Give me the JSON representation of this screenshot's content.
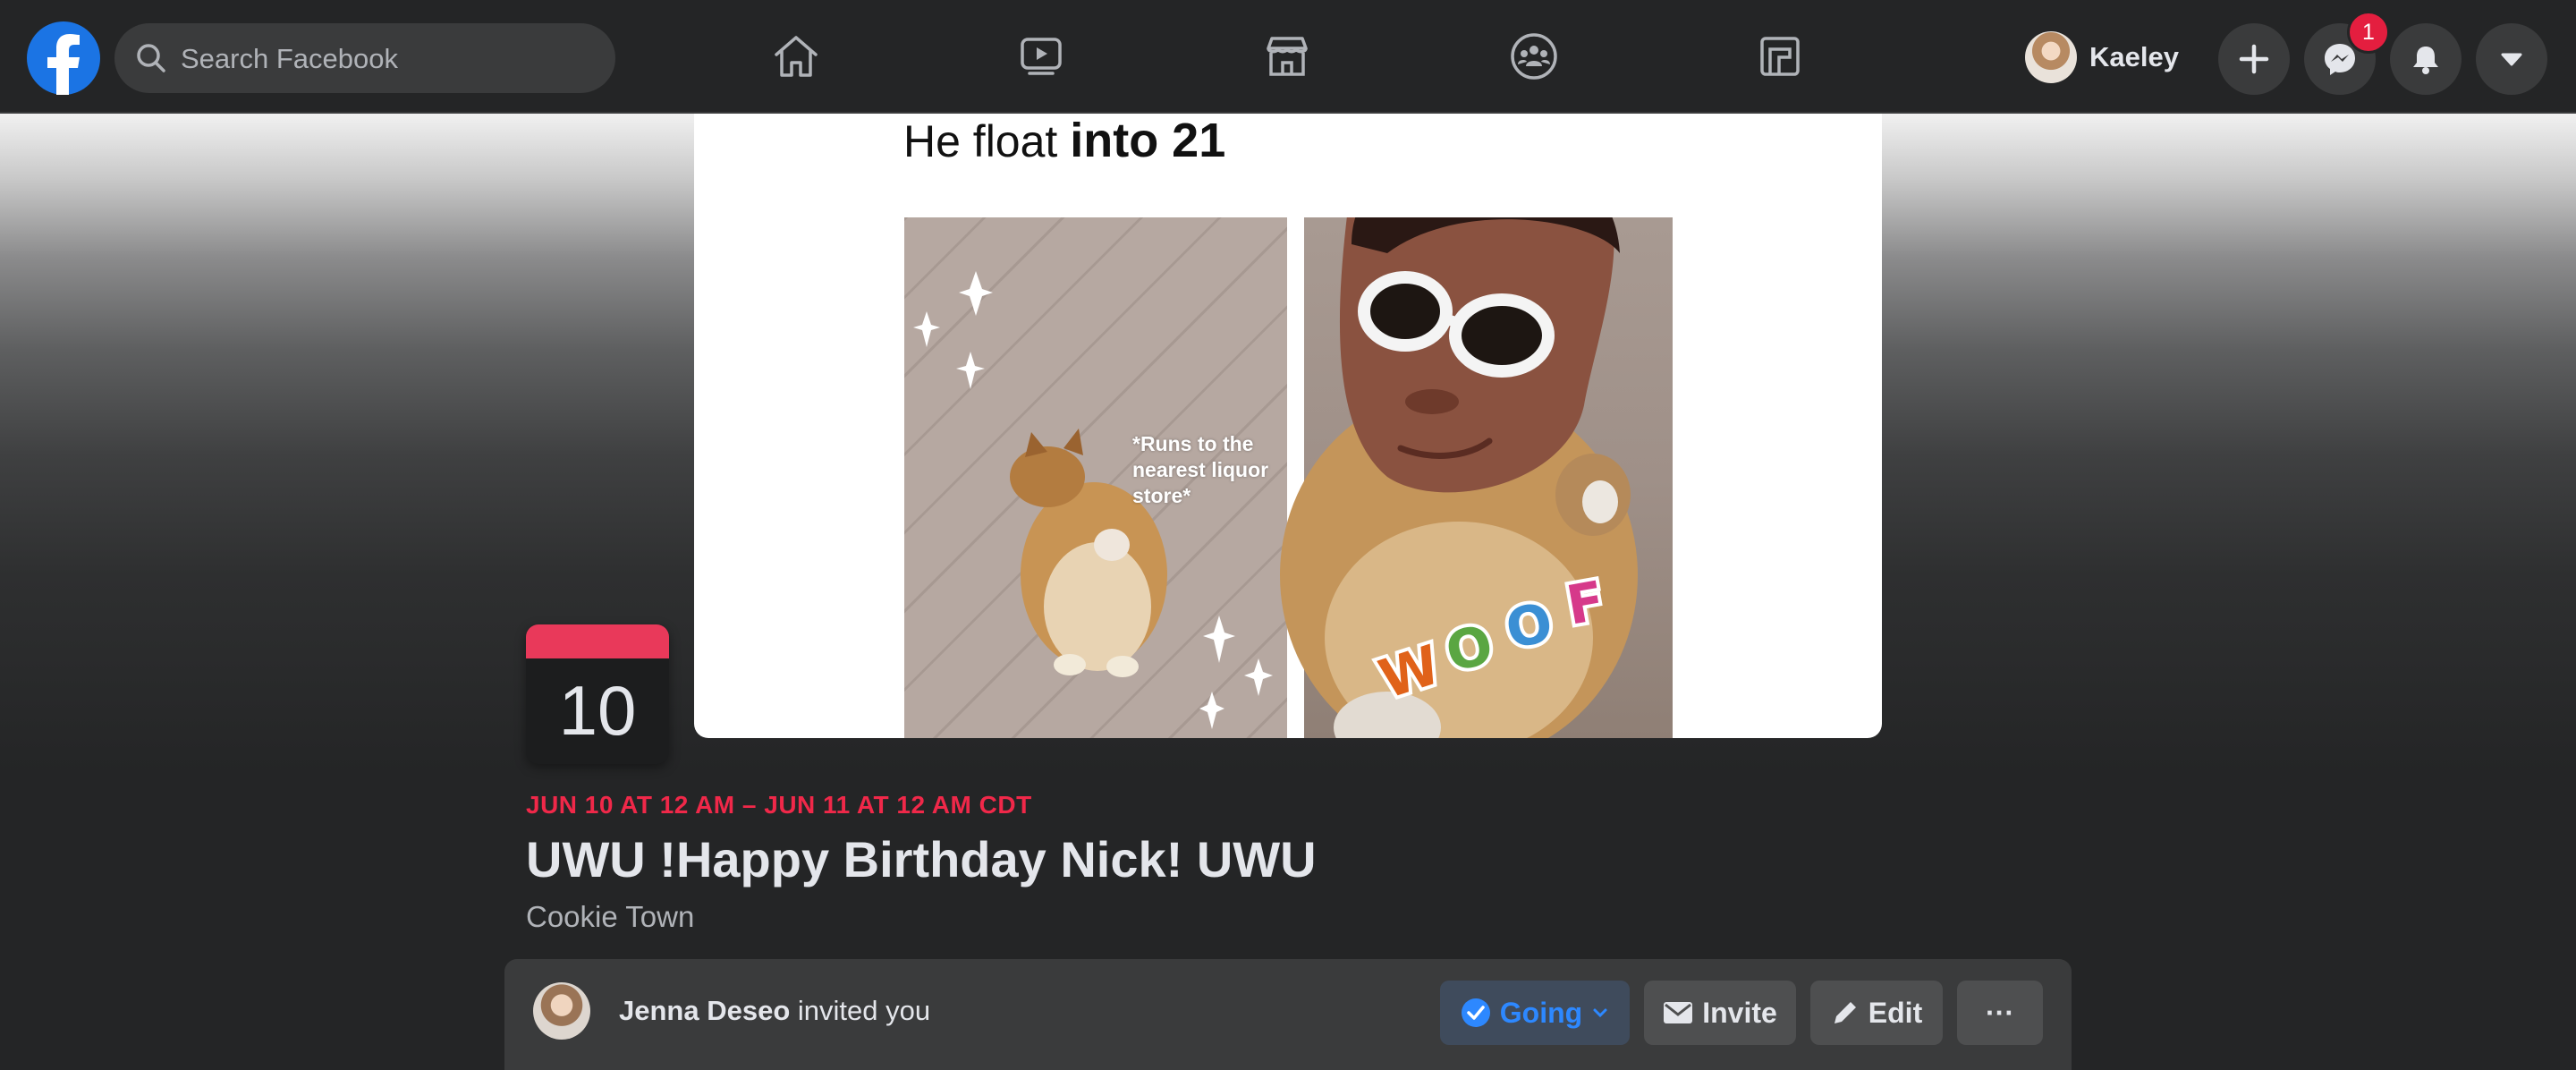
{
  "header": {
    "logo_name": "facebook-logo",
    "search_placeholder": "Search Facebook",
    "nav_icons": [
      "home-icon",
      "watch-icon",
      "marketplace-icon",
      "groups-icon",
      "gaming-icon"
    ],
    "profile_name": "Kaeley",
    "messenger_badge": "1"
  },
  "cover": {
    "meme_caption_light": "He float ",
    "meme_caption_bold": "into 21",
    "meme_side_text": "*Runs to the nearest liquor store*",
    "meme_sticker_text": "WOOF"
  },
  "event": {
    "date_day": "10",
    "when": "JUN 10 AT 12 AM – JUN 11 AT 12 AM CDT",
    "title": "UWU !Happy Birthday Nick! UWU",
    "location": "Cookie Town",
    "inviter_name": "Jenna Deseo",
    "invite_suffix": " invited you",
    "actions": {
      "going": "Going",
      "invite": "Invite",
      "edit": "Edit",
      "more": "···"
    }
  },
  "colors": {
    "background": "#242526",
    "surface": "#3a3b3c",
    "accent_blue": "#2d88ff",
    "date_red": "#f02849",
    "badge_red": "#e41e3f"
  }
}
